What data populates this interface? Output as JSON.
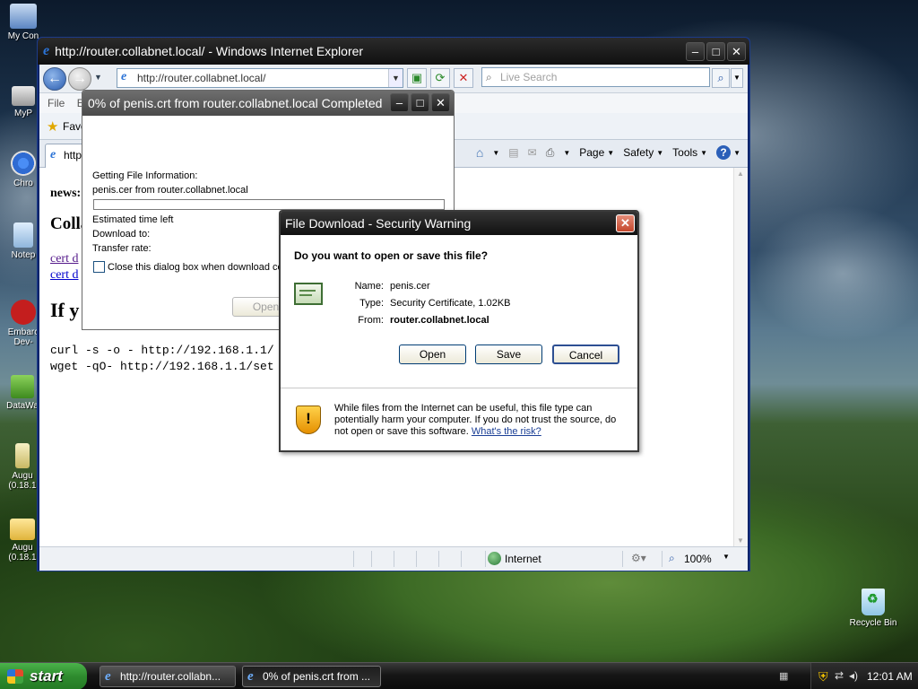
{
  "desktop": {
    "icons": [
      {
        "label": "My Con"
      },
      {
        "label": "MyP"
      },
      {
        "label": "Chro"
      },
      {
        "label": "Notep"
      },
      {
        "label": "Embarc Dev-"
      },
      {
        "label": "DataWa"
      },
      {
        "label": "Augu (0.18.1"
      },
      {
        "label": "Augu (0.18.1"
      }
    ],
    "recycle_bin": "Recycle Bin"
  },
  "ie": {
    "title": "http://router.collabnet.local/ - Windows Internet Explorer",
    "address": "http://router.collabnet.local/",
    "search_placeholder": "Live Search",
    "menu": [
      "File",
      "E"
    ],
    "favorites_label": "Favo",
    "tab_label": "http",
    "commands": {
      "page": "Page",
      "safety": "Safety",
      "tools": "Tools"
    },
    "content": {
      "news_label": "news:",
      "heading_coll": "Colla",
      "link1": "cert d",
      "link2": "cert d",
      "heading_if": "If y",
      "curl_line": "curl -s -o - http://192.168.1.1/",
      "wget_line": "wget -qO- http://192.168.1.1/set"
    },
    "status": {
      "zone": "Internet",
      "zoom": "100%"
    }
  },
  "download_progress": {
    "title": "0% of penis.crt from router.collabnet.local Completed",
    "getting_info": "Getting File Information:",
    "file_from": "penis.cer from router.collabnet.local",
    "progress": 0,
    "estimated_time": "Estimated time left",
    "download_to": "Download to:",
    "transfer_rate": "Transfer rate:",
    "close_checkbox": "Close this dialog box when download cor",
    "open_button": "Open"
  },
  "security_dialog": {
    "title": "File Download - Security Warning",
    "question": "Do you want to open or save this file?",
    "name_label": "Name:",
    "name_value": "penis.cer",
    "type_label": "Type:",
    "type_value": "Security Certificate, 1.02KB",
    "from_label": "From:",
    "from_value": "router.collabnet.local",
    "open_button": "Open",
    "save_button": "Save",
    "cancel_button": "Cancel",
    "warning_text": "While files from the Internet can be useful, this file type can potentially harm your computer. If you do not trust the source, do not open or save this software.",
    "risk_link": "What's the risk?"
  },
  "taskbar": {
    "start_label": "start",
    "tasks": [
      {
        "label": "http://router.collabn..."
      },
      {
        "label": "0% of penis.crt from ..."
      }
    ],
    "clock": "12:01 AM"
  }
}
